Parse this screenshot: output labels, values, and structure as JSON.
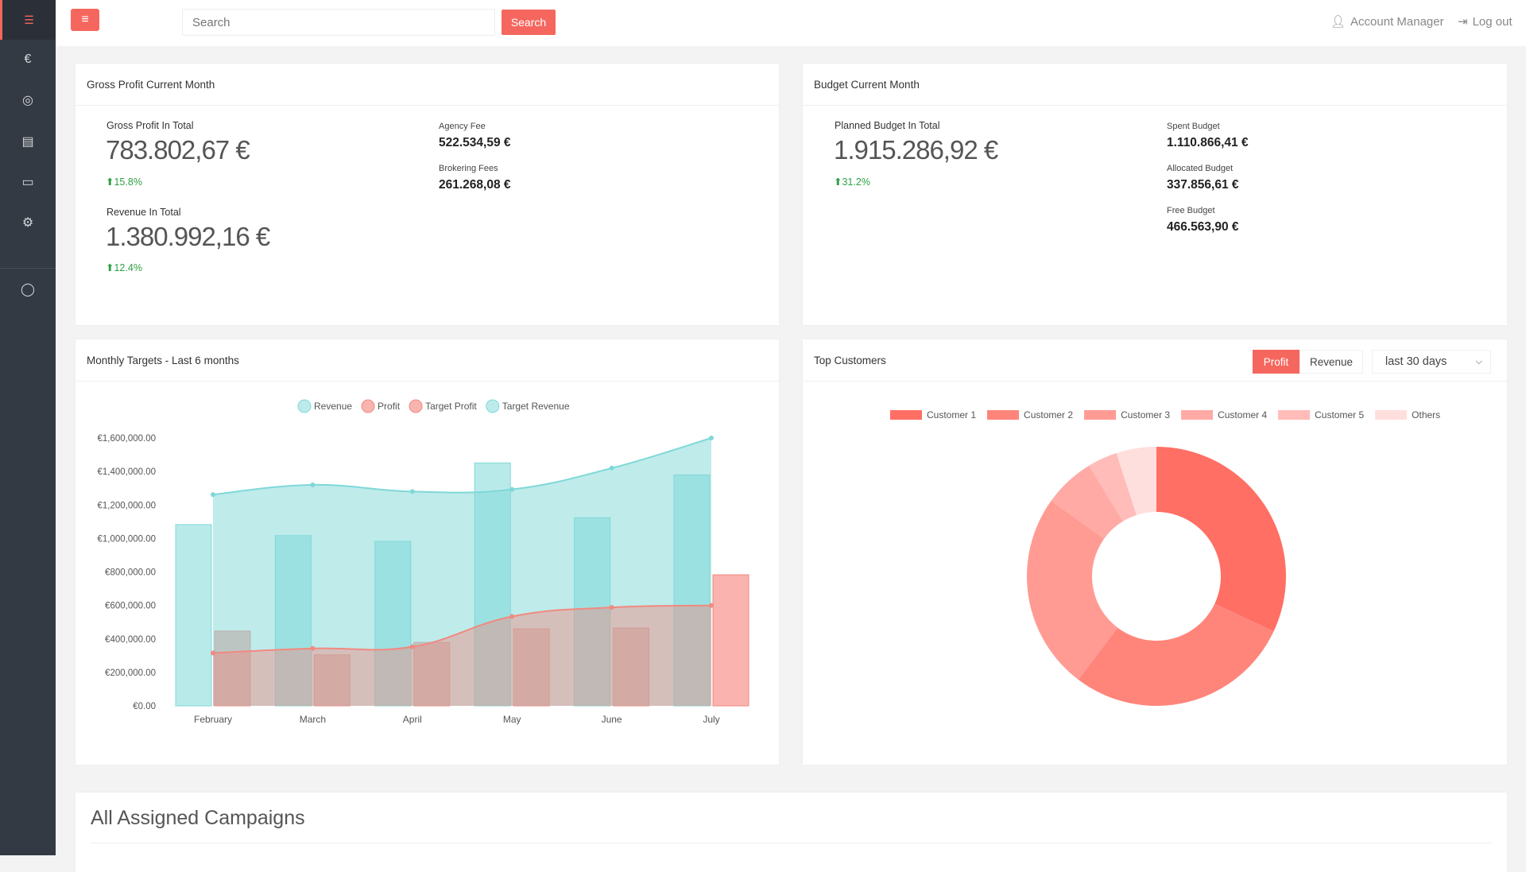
{
  "sidebar": {
    "items": [
      {
        "icon": "server-icon",
        "glyph": "☰"
      },
      {
        "icon": "euro-icon",
        "glyph": "€"
      },
      {
        "icon": "instagram-icon",
        "glyph": "◎"
      },
      {
        "icon": "id-card-icon",
        "glyph": "▤"
      },
      {
        "icon": "calendar-icon",
        "glyph": "▭"
      },
      {
        "icon": "gears-icon",
        "glyph": "⚙"
      },
      {
        "icon": "github-icon",
        "glyph": "◯"
      }
    ]
  },
  "topbar": {
    "menu_glyph": "≡",
    "search_placeholder": "Search",
    "search_button": "Search",
    "account": "Account Manager",
    "logout": "Log out"
  },
  "gross": {
    "title": "Gross Profit Current Month",
    "gp_label": "Gross Profit In Total",
    "gp_value": "783.802,67 €",
    "gp_change": "15.8%",
    "rev_label": "Revenue In Total",
    "rev_value": "1.380.992,16 €",
    "rev_change": "12.4%",
    "agency_label": "Agency Fee",
    "agency_value": "522.534,59 €",
    "brokering_label": "Brokering Fees",
    "brokering_value": "261.268,08 €"
  },
  "budget": {
    "title": "Budget Current Month",
    "planned_label": "Planned Budget In Total",
    "planned_value": "1.915.286,92 €",
    "planned_change": "31.2%",
    "spent_label": "Spent Budget",
    "spent_value": "1.110.866,41 €",
    "allocated_label": "Allocated Budget",
    "allocated_value": "337.856,61 €",
    "free_label": "Free Budget",
    "free_value": "466.563,90 €"
  },
  "targets": {
    "title": "Monthly Targets - Last 6 months"
  },
  "customers": {
    "title": "Top Customers",
    "toggle": [
      "Profit",
      "Revenue"
    ],
    "active_toggle": "Profit",
    "range": "last 30 days"
  },
  "campaigns": {
    "title": "All Assigned Campaigns"
  },
  "colors": {
    "accent": "#f5675e",
    "teal": "#7fd8d8",
    "green": "#2ea043"
  },
  "chart_data": [
    {
      "type": "bar+line",
      "categories": [
        "February",
        "March",
        "April",
        "May",
        "June",
        "July"
      ],
      "ylim": [
        0,
        1600000
      ],
      "yticks": [
        "€0.00",
        "€200,000.00",
        "€400,000.00",
        "€600,000.00",
        "€800,000.00",
        "€1,000,000.00",
        "€1,200,000.00",
        "€1,400,000.00",
        "€1,600,000.00"
      ],
      "legend_position": "top",
      "series": [
        {
          "name": "Revenue",
          "kind": "bar",
          "color": "#7fd8d8",
          "values": [
            1083000,
            1017000,
            983000,
            1451000,
            1124000,
            1379000
          ]
        },
        {
          "name": "Profit",
          "kind": "bar",
          "color": "#f5675e",
          "values": [
            447000,
            305000,
            379000,
            460000,
            465000,
            783000
          ]
        },
        {
          "name": "Target Profit",
          "kind": "area",
          "color": "#f08a80",
          "values": [
            316000,
            343000,
            353000,
            534000,
            588000,
            600000
          ]
        },
        {
          "name": "Target Revenue",
          "kind": "area",
          "color": "#7fd8d8",
          "values": [
            1262000,
            1320000,
            1280000,
            1293000,
            1420000,
            1600000
          ]
        }
      ]
    },
    {
      "type": "pie",
      "donut": true,
      "legend_position": "top",
      "labels": [
        "Customer 1",
        "Customer 2",
        "Customer 3",
        "Customer 4",
        "Customer 5",
        "Others"
      ],
      "values": [
        32.0,
        28.3,
        24.6,
        6.4,
        3.7,
        5.0
      ],
      "colors": [
        "#ff6f64",
        "#ff857b",
        "#ff9b93",
        "#ffaaa5",
        "#ffbcb8",
        "#ffdfdd"
      ]
    }
  ]
}
